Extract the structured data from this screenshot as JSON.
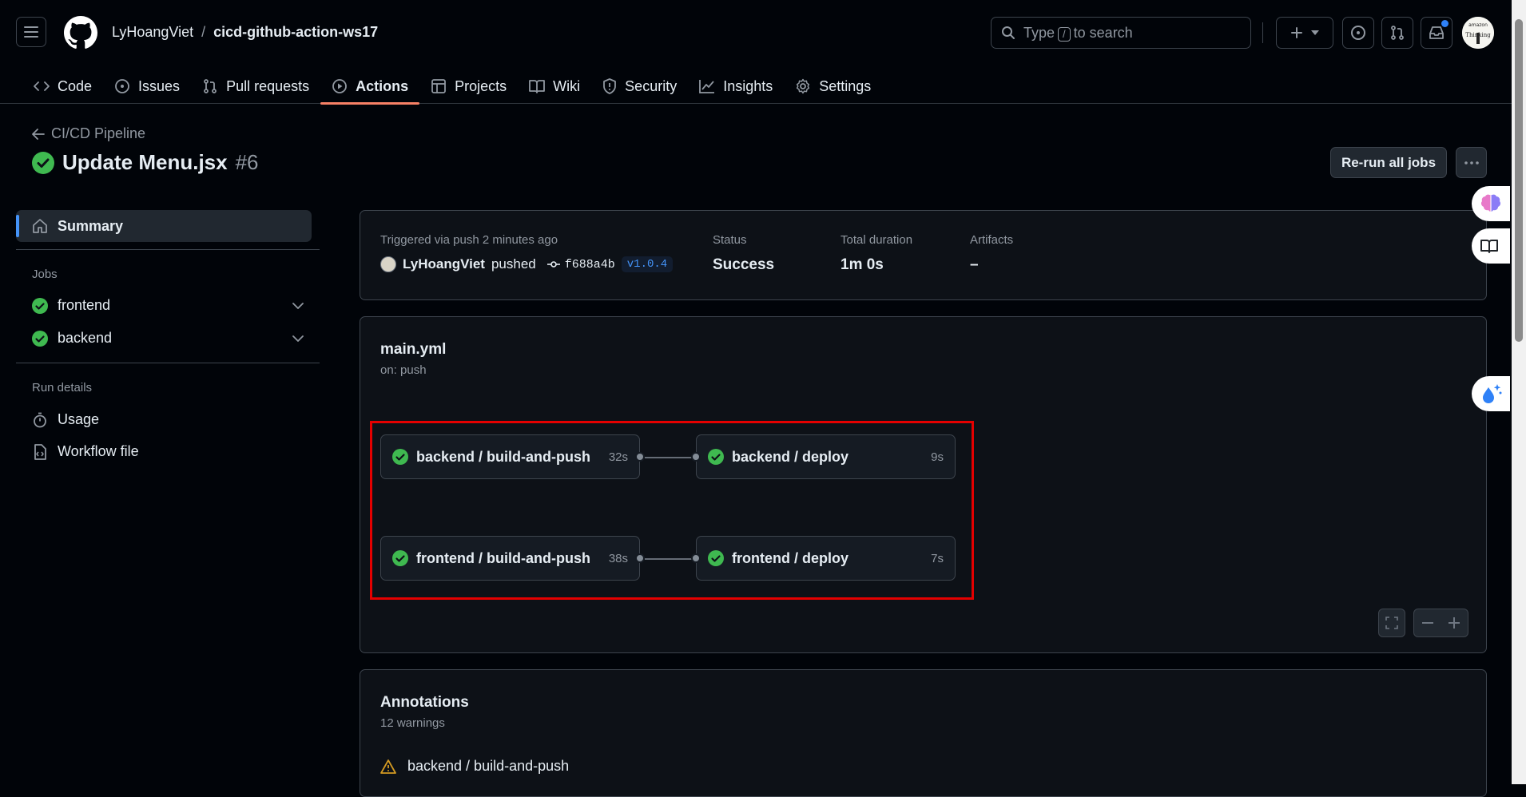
{
  "header": {
    "repo_owner": "LyHoangViet",
    "repo_separator": "/",
    "repo_name": "cicd-github-action-ws17",
    "search_prefix": "Type",
    "search_key": "/",
    "search_suffix": "to search",
    "avatar_text": "amazon\nThinking"
  },
  "tabs": [
    {
      "label": "Code",
      "icon": "code-icon"
    },
    {
      "label": "Issues",
      "icon": "issue-opened-icon"
    },
    {
      "label": "Pull requests",
      "icon": "git-pull-request-icon"
    },
    {
      "label": "Actions",
      "icon": "play-icon",
      "active": true
    },
    {
      "label": "Projects",
      "icon": "table-icon"
    },
    {
      "label": "Wiki",
      "icon": "book-icon"
    },
    {
      "label": "Security",
      "icon": "shield-icon"
    },
    {
      "label": "Insights",
      "icon": "graph-icon"
    },
    {
      "label": "Settings",
      "icon": "gear-icon"
    }
  ],
  "run": {
    "back_label": "CI/CD Pipeline",
    "title": "Update Menu.jsx",
    "number": "#6",
    "rerun_label": "Re-run all jobs"
  },
  "sidebar": {
    "summary_label": "Summary",
    "jobs_heading": "Jobs",
    "jobs": [
      {
        "label": "frontend"
      },
      {
        "label": "backend"
      }
    ],
    "run_details_heading": "Run details",
    "details": [
      {
        "label": "Usage",
        "icon": "stopwatch-icon"
      },
      {
        "label": "Workflow file",
        "icon": "file-code-icon"
      }
    ]
  },
  "summary": {
    "trigger_label": "Triggered via push 2 minutes ago",
    "actor": "LyHoangViet",
    "action": "pushed",
    "commit_sha": "f688a4b",
    "tag": "v1.0.4",
    "status_label": "Status",
    "status_value": "Success",
    "duration_label": "Total duration",
    "duration_value": "1m 0s",
    "artifacts_label": "Artifacts",
    "artifacts_value": "–"
  },
  "workflow": {
    "file": "main.yml",
    "trigger": "on: push",
    "jobs": [
      {
        "name": "backend / build-and-push",
        "duration": "32s"
      },
      {
        "name": "backend / deploy",
        "duration": "9s"
      },
      {
        "name": "frontend / build-and-push",
        "duration": "38s"
      },
      {
        "name": "frontend / deploy",
        "duration": "7s"
      }
    ]
  },
  "annotations": {
    "title": "Annotations",
    "count": "12 warnings",
    "first_item": "backend / build-and-push"
  },
  "colors": {
    "success": "#3fb950",
    "accent": "#4493f8",
    "active_tab_underline": "#f78166",
    "highlight_box": "#e40000",
    "warning": "#d29922"
  }
}
